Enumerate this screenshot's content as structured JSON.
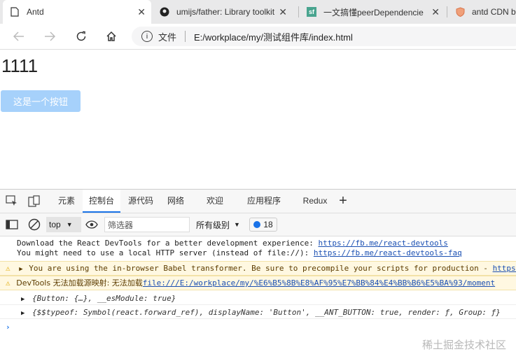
{
  "browser": {
    "tabs": [
      {
        "label": "Antd",
        "icon": "page-icon"
      },
      {
        "label": "umijs/father: Library toolkit",
        "icon": "github-icon"
      },
      {
        "label": "一文搞懂peerDependencie",
        "icon": "sf-icon"
      },
      {
        "label": "antd CDN b",
        "icon": "shield-icon"
      }
    ],
    "address": {
      "prefix": "文件",
      "url": "E:/workplace/my/测试组件库/index.html"
    }
  },
  "page": {
    "title": "1111",
    "button_label": "这是一个按钮"
  },
  "devtools": {
    "tabs": [
      "元素",
      "控制台",
      "源代码",
      "网络",
      "欢迎",
      "应用程序",
      "Redux"
    ],
    "active_tab": "控制台",
    "context": "top",
    "filter_placeholder": "筛选器",
    "levels": "所有级别",
    "issue_count": "18",
    "messages": {
      "info1_text": "Download the React DevTools for a better development experience: ",
      "info1_link": "https://fb.me/react-devtools",
      "info2_text": "You might need to use a local HTTP server (instead of file://): ",
      "info2_link": "https://fb.me/react-devtools-faq",
      "warn1_text": "You are using the in-browser Babel transformer. Be sure to precompile your scripts for production - ",
      "warn1_link": "https:",
      "warn2_text": "DevTools 无法加载源映射: 无法加载",
      "warn2_link": "file:///E:/workplace/my/%E6%B5%8B%E8%AF%95%E7%BB%84%E4%BB%B6%E5%BA%93/moment",
      "obj1": "{Button: {…}, __esModule: true}",
      "obj2": "{$$typeof: Symbol(react.forward_ref), displayName: 'Button', __ANT_BUTTON: true, render: ƒ, Group: ƒ}"
    }
  },
  "watermark": "稀土掘金技术社区"
}
